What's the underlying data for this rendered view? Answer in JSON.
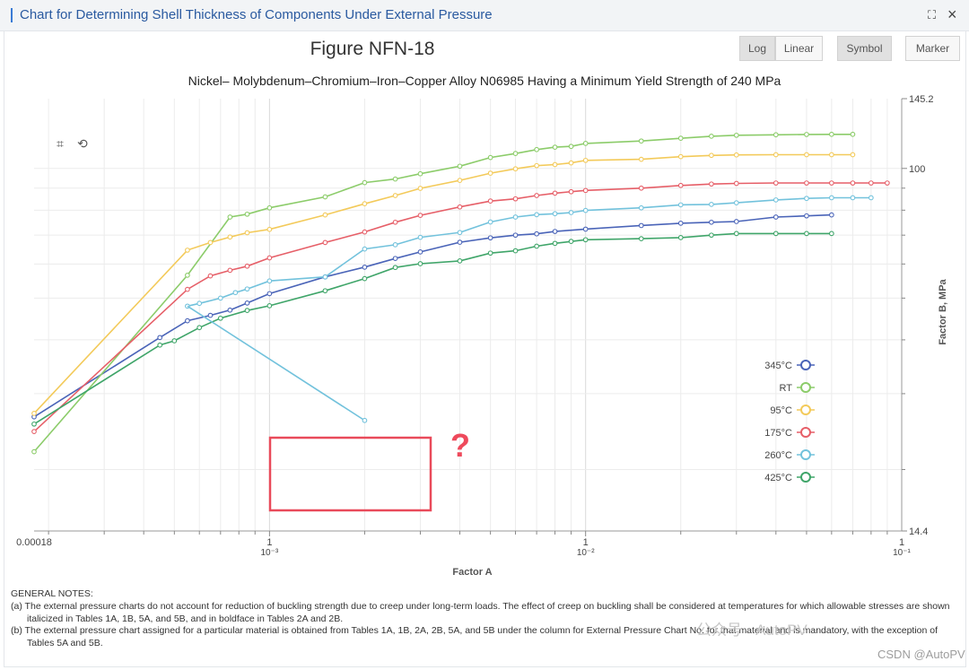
{
  "window": {
    "title": "Chart for Determining Shell Thickness of Components Under External Pressure",
    "maximize_icon": "expand-icon",
    "close_icon": "close-icon"
  },
  "toolbar": {
    "log_label": "Log",
    "linear_label": "Linear",
    "symbol_label": "Symbol",
    "marker_label": "Marker"
  },
  "tools": {
    "zoom_icon": "zoom-select-icon",
    "reset_icon": "zoom-reset-icon"
  },
  "annotation": {
    "question_mark": "?",
    "highlight_color": "#e94a5a"
  },
  "chart_data": {
    "type": "line",
    "title": "Figure NFN-18",
    "subtitle": "Nickel– Molybdenum–Chromium–Iron–Copper Alloy N06985 Having a Minimum Yield Strength of 240 MPa",
    "xlabel": "Factor A",
    "ylabel": "Factor B, MPa",
    "x_scale": "log",
    "y_scale": "log",
    "xlim": [
      0.00018,
      0.1
    ],
    "ylim": [
      14.4,
      145.2
    ],
    "x_tick_labels": [
      {
        "value": 0.00018,
        "label": "0.00018",
        "exp": ""
      },
      {
        "value": 0.001,
        "label": "1",
        "exp": "10⁻³"
      },
      {
        "value": 0.01,
        "label": "1",
        "exp": "10⁻²"
      },
      {
        "value": 0.1,
        "label": "1",
        "exp": "10⁻¹"
      }
    ],
    "y_tick_labels": [
      {
        "value": 145.2,
        "label": "145.2"
      },
      {
        "value": 100,
        "label": "100"
      },
      {
        "value": 14.4,
        "label": "14.4"
      }
    ],
    "grid": true,
    "legend_position": "right",
    "series": [
      {
        "name": "345°C",
        "color": "#4a64b8",
        "x": [
          0.00018,
          0.00045,
          0.00055,
          0.00065,
          0.00075,
          0.00085,
          0.001,
          0.0015,
          0.002,
          0.0025,
          0.003,
          0.004,
          0.005,
          0.006,
          0.007,
          0.008,
          0.01,
          0.015,
          0.02,
          0.025,
          0.03,
          0.04,
          0.05,
          0.06
        ],
        "y": [
          26.5,
          40.5,
          44.3,
          45.6,
          46.9,
          48.7,
          51.2,
          56.0,
          59.0,
          61.8,
          64.0,
          67.4,
          69.0,
          70.0,
          70.5,
          71.4,
          72.3,
          73.7,
          74.6,
          75.0,
          75.3,
          77.1,
          77.6,
          78.0
        ]
      },
      {
        "name": "RT",
        "color": "#8ccc6a",
        "x": [
          0.00018,
          0.00055,
          0.00075,
          0.00085,
          0.001,
          0.0015,
          0.002,
          0.0025,
          0.003,
          0.004,
          0.005,
          0.006,
          0.007,
          0.008,
          0.009,
          0.01,
          0.015,
          0.02,
          0.025,
          0.03,
          0.04,
          0.05,
          0.06,
          0.07
        ],
        "y": [
          22.0,
          56.5,
          77.1,
          78.3,
          81.0,
          85.9,
          92.7,
          94.5,
          97.2,
          101.2,
          106.0,
          108.3,
          110.6,
          112.0,
          112.5,
          114.3,
          115.8,
          117.5,
          118.8,
          119.4,
          119.7,
          119.9,
          120.0,
          120.0
        ]
      },
      {
        "name": "95°C",
        "color": "#f3ca5a",
        "x": [
          0.00018,
          0.00055,
          0.00065,
          0.00075,
          0.00085,
          0.001,
          0.0015,
          0.002,
          0.0025,
          0.003,
          0.004,
          0.005,
          0.006,
          0.007,
          0.008,
          0.009,
          0.01,
          0.015,
          0.02,
          0.025,
          0.03,
          0.04,
          0.05,
          0.06,
          0.07
        ],
        "y": [
          27.0,
          64.6,
          67.3,
          69.3,
          70.9,
          72.2,
          78.0,
          82.8,
          86.5,
          89.9,
          93.8,
          97.5,
          99.8,
          101.5,
          102.1,
          103.0,
          104.4,
          105.0,
          106.5,
          107.2,
          107.5,
          107.6,
          107.6,
          107.6,
          107.6
        ]
      },
      {
        "name": "175°C",
        "color": "#e65f68",
        "x": [
          0.00018,
          0.00055,
          0.00065,
          0.00075,
          0.00085,
          0.001,
          0.0015,
          0.002,
          0.0025,
          0.003,
          0.004,
          0.005,
          0.006,
          0.007,
          0.008,
          0.009,
          0.01,
          0.015,
          0.02,
          0.025,
          0.03,
          0.04,
          0.05,
          0.06,
          0.07,
          0.08,
          0.09
        ],
        "y": [
          24.5,
          52.4,
          56.3,
          58.0,
          59.3,
          62.0,
          67.3,
          71.2,
          75.0,
          77.8,
          81.4,
          84.0,
          85.0,
          86.5,
          87.6,
          88.3,
          88.9,
          90.0,
          91.3,
          92.0,
          92.3,
          92.5,
          92.5,
          92.5,
          92.5,
          92.5,
          92.5
        ]
      },
      {
        "name": "260°C",
        "color": "#72c2dc",
        "x": [
          0.00055,
          0.0006,
          0.0007,
          0.00078,
          0.00085,
          0.001,
          0.0015,
          0.002,
          0.0025,
          0.003,
          0.004,
          0.005,
          0.006,
          0.007,
          0.008,
          0.009,
          0.01,
          0.015,
          0.02,
          0.025,
          0.03,
          0.04,
          0.05,
          0.06,
          0.07,
          0.08
        ],
        "y": [
          47.9,
          48.6,
          50.0,
          51.5,
          52.5,
          54.8,
          56.0,
          65.0,
          66.5,
          69.2,
          71.0,
          75.1,
          77.1,
          78.1,
          78.5,
          79.0,
          79.9,
          81.0,
          82.3,
          82.5,
          83.2,
          84.5,
          85.2,
          85.5,
          85.5,
          85.5
        ]
      },
      {
        "name": "425°C",
        "color": "#3fa569",
        "x": [
          0.00018,
          0.00045,
          0.0005,
          0.0006,
          0.0007,
          0.00085,
          0.001,
          0.0015,
          0.002,
          0.0025,
          0.003,
          0.004,
          0.005,
          0.006,
          0.007,
          0.008,
          0.009,
          0.01,
          0.015,
          0.02,
          0.025,
          0.03,
          0.04,
          0.05,
          0.06
        ],
        "y": [
          25.5,
          38.9,
          39.8,
          42.7,
          44.9,
          46.8,
          48.0,
          52.0,
          55.5,
          58.9,
          60.1,
          61.0,
          63.6,
          64.4,
          66.0,
          67.0,
          67.7,
          68.3,
          68.7,
          69.1,
          70.0,
          70.6,
          70.6,
          70.6,
          70.6
        ]
      }
    ],
    "stray_segment": {
      "series": "260°C",
      "x": [
        0.00055,
        0.002
      ],
      "y": [
        47.9,
        26.0
      ]
    }
  },
  "notes": {
    "heading": "GENERAL NOTES:",
    "a": "(a) The external pressure charts do not account for reduction of buckling strength due to creep under long-term loads. The effect of creep on buckling shall be considered at temperatures for which allowable stresses are shown italicized in Tables 1A, 1B, 5A, and 5B, and in boldface in Tables 2A and 2B.",
    "b": "(b) The external pressure chart assigned for a particular material is obtained from Tables 1A, 1B, 2A, 2B, 5A, and 5B under the column for External Pressure Chart No. for that material and is mandatory, with the exception of Tables 5A and 5B."
  },
  "watermark": {
    "wechat": "公众号 · AutoPV",
    "csdn": "CSDN @AutoPV"
  }
}
